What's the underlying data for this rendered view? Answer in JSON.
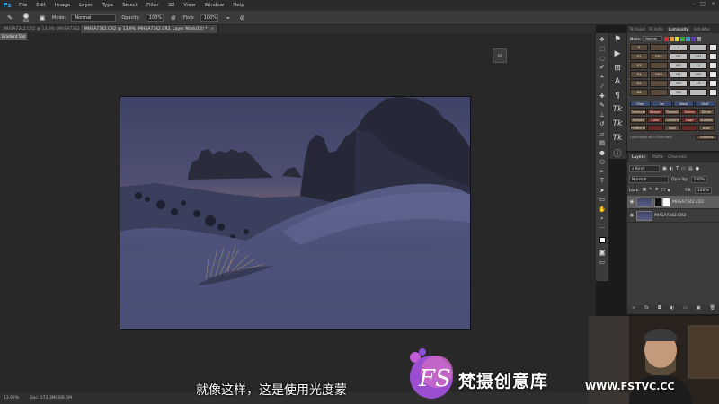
{
  "app": {
    "logo": "Ps"
  },
  "menu": [
    "File",
    "Edit",
    "Image",
    "Layer",
    "Type",
    "Select",
    "Filter",
    "3D",
    "View",
    "Window",
    "Help"
  ],
  "options": {
    "size": "500",
    "mode_label": "Mode:",
    "mode_value": "Normal",
    "opacity_label": "Opacity:",
    "opacity_value": "100%",
    "flow_label": "Flow:",
    "flow_value": "100%"
  },
  "tabs": [
    {
      "label": "MHSA7342.CR2 @ 13.9% (MHSA7342.CR2, Layer Mask/16) *"
    },
    {
      "label": "MHSA7342.CR2 @ 13.9% (MHSA7342.CR2, Layer Mask/16) *",
      "close": "×"
    }
  ],
  "floating_tool": "Gradient Tool",
  "float_widget": "02",
  "status": {
    "zoom": "13.92%",
    "doc": "Doc: 173.3M/306.5M"
  },
  "lumi_panel": {
    "tabs": [
      "TK Rapid",
      "TK Actio",
      "Luminosity",
      "InitiaMas"
    ],
    "active": "Luminosity",
    "mode_label": "Mode:",
    "mode_value": "Normal",
    "rows": [
      [
        "D",
        "",
        "L",
        ""
      ],
      [
        "D2",
        "DM1",
        "M2",
        "LM1"
      ],
      [
        "D3",
        "",
        "M3",
        "L2"
      ],
      [
        "D4",
        "DM2",
        "M4",
        "LM2"
      ],
      [
        "D5",
        "",
        "M5",
        "L3"
      ],
      [
        "D6",
        "",
        "M6",
        ""
      ]
    ],
    "btn_rows": [
      [
        "Filter",
        "Sel",
        "Mask",
        "Stuff"
      ],
      [
        "Overlayed",
        "Rodger",
        "Repaint",
        "Stamp",
        "Dither"
      ],
      [
        "Sample",
        "Color",
        "Combine",
        "Edge",
        "Shadow"
      ],
      [
        "PreBlend",
        "",
        "Split",
        "",
        "Bath"
      ]
    ],
    "footer": "Luminosity v6.0  Chris Kent",
    "tutorials": "Tutorials"
  },
  "layers_panel": {
    "tabs": [
      "Layers",
      "Paths",
      "Channels"
    ],
    "kind": "Kind",
    "blend": "Normal",
    "opacity_label": "Opacity:",
    "opacity_value": "100%",
    "lock_label": "Lock:",
    "fill_label": "Fill:",
    "fill_value": "100%",
    "layers": [
      {
        "name": "MHSA7342.CR2",
        "selected": true
      },
      {
        "name": "MHSA7342.CR2",
        "selected": false
      }
    ]
  },
  "subtitle": "就像这样，这是使用光度蒙",
  "watermark": {
    "text": "梵摄创意库",
    "url": "WWW.FSTVC.CC"
  }
}
